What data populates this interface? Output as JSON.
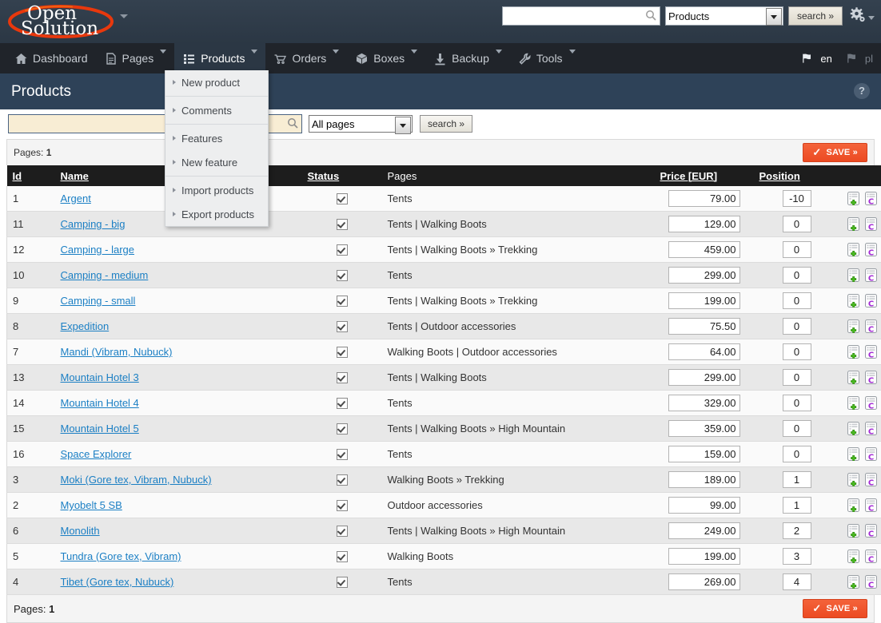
{
  "header": {
    "logo_line1": "Open",
    "logo_line2": "Solution",
    "global_search": {
      "value": "",
      "placeholder": "",
      "scope": "Products",
      "button": "search »",
      "icon": "search-icon"
    },
    "gear_icon": "gear-icon"
  },
  "nav": {
    "items": [
      {
        "label": "Dashboard",
        "icon": "home-icon",
        "has_dropdown": false,
        "active": false
      },
      {
        "label": "Pages",
        "icon": "document-icon",
        "has_dropdown": true,
        "active": false
      },
      {
        "label": "Products",
        "icon": "list-icon",
        "has_dropdown": true,
        "active": true
      },
      {
        "label": "Orders",
        "icon": "cart-icon",
        "has_dropdown": true,
        "active": false
      },
      {
        "label": "Boxes",
        "icon": "box-icon",
        "has_dropdown": true,
        "active": false
      },
      {
        "label": "Backup",
        "icon": "download-icon",
        "has_dropdown": true,
        "active": false
      },
      {
        "label": "Tools",
        "icon": "wrench-icon",
        "has_dropdown": true,
        "active": false
      }
    ],
    "languages": [
      {
        "code": "en",
        "active": true,
        "icon": "flag-icon"
      },
      {
        "code": "pl",
        "active": false,
        "icon": "flag-icon"
      }
    ]
  },
  "dropdown_menu": {
    "open_for": "Products",
    "groups": [
      [
        "New product"
      ],
      [
        "Comments"
      ],
      [
        "Features",
        "New feature"
      ],
      [
        "Import products",
        "Export products"
      ]
    ]
  },
  "page": {
    "title": "Products",
    "help_icon": "help-icon",
    "help_label": "?"
  },
  "filter": {
    "search_value": "",
    "search_placeholder": "",
    "search_icon": "search-icon",
    "page_select": "All pages",
    "page_select_options": [
      "All pages"
    ],
    "search_button": "search »"
  },
  "pagination_top": {
    "label": "Pages:",
    "value": "1"
  },
  "pagination_bottom": {
    "label": "Pages:",
    "value": "1"
  },
  "save_button": {
    "label": "SAVE »",
    "check": "✓",
    "color": "#ec4a22"
  },
  "table": {
    "columns": [
      {
        "key": "id",
        "label": "Id",
        "sortable": true
      },
      {
        "key": "name",
        "label": "Name",
        "sortable": true
      },
      {
        "key": "status",
        "label": "Status",
        "sortable": true
      },
      {
        "key": "pages",
        "label": "Pages",
        "sortable": false
      },
      {
        "key": "price",
        "label": "Price [EUR]",
        "sortable": true
      },
      {
        "key": "position",
        "label": "Position",
        "sortable": true
      },
      {
        "key": "actions",
        "label": "",
        "sortable": false
      }
    ],
    "row_actions": [
      {
        "name": "add-icon",
        "title": "add"
      },
      {
        "name": "copy-icon",
        "title": "copy"
      },
      {
        "name": "edit-icon",
        "title": "edit"
      },
      {
        "name": "delete-icon",
        "title": "delete"
      }
    ],
    "rows": [
      {
        "id": "1",
        "name": "Argent",
        "status": true,
        "pages": "Tents",
        "price": "79.00",
        "position": "-10"
      },
      {
        "id": "11",
        "name": "Camping - big",
        "status": true,
        "pages": "Tents | Walking Boots",
        "price": "129.00",
        "position": "0"
      },
      {
        "id": "12",
        "name": "Camping - large",
        "status": true,
        "pages": "Tents | Walking Boots » Trekking",
        "price": "459.00",
        "position": "0"
      },
      {
        "id": "10",
        "name": "Camping - medium",
        "status": true,
        "pages": "Tents",
        "price": "299.00",
        "position": "0"
      },
      {
        "id": "9",
        "name": "Camping - small",
        "status": true,
        "pages": "Tents | Walking Boots » Trekking",
        "price": "199.00",
        "position": "0"
      },
      {
        "id": "8",
        "name": "Expedition",
        "status": true,
        "pages": "Tents | Outdoor accessories",
        "price": "75.50",
        "position": "0"
      },
      {
        "id": "7",
        "name": "Mandi (Vibram, Nubuck)",
        "status": true,
        "pages": "Walking Boots | Outdoor accessories",
        "price": "64.00",
        "position": "0"
      },
      {
        "id": "13",
        "name": "Mountain Hotel 3",
        "status": true,
        "pages": "Tents | Walking Boots",
        "price": "299.00",
        "position": "0"
      },
      {
        "id": "14",
        "name": "Mountain Hotel 4",
        "status": true,
        "pages": "Tents",
        "price": "329.00",
        "position": "0"
      },
      {
        "id": "15",
        "name": "Mountain Hotel 5",
        "status": true,
        "pages": "Tents | Walking Boots » High Mountain",
        "price": "359.00",
        "position": "0"
      },
      {
        "id": "16",
        "name": "Space Explorer",
        "status": true,
        "pages": "Tents",
        "price": "159.00",
        "position": "0"
      },
      {
        "id": "3",
        "name": "Moki (Gore tex, Vibram, Nubuck)",
        "status": true,
        "pages": "Walking Boots » Trekking",
        "price": "189.00",
        "position": "1"
      },
      {
        "id": "2",
        "name": "Myobelt 5 SB",
        "status": true,
        "pages": "Outdoor accessories",
        "price": "99.00",
        "position": "1"
      },
      {
        "id": "6",
        "name": "Monolith",
        "status": true,
        "pages": "Tents | Walking Boots » High Mountain",
        "price": "249.00",
        "position": "2"
      },
      {
        "id": "5",
        "name": "Tundra (Gore tex, Vibram)",
        "status": true,
        "pages": "Walking Boots",
        "price": "199.00",
        "position": "3"
      },
      {
        "id": "4",
        "name": "Tibet (Gore tex, Nubuck)",
        "status": true,
        "pages": "Tents",
        "price": "269.00",
        "position": "4"
      }
    ]
  }
}
